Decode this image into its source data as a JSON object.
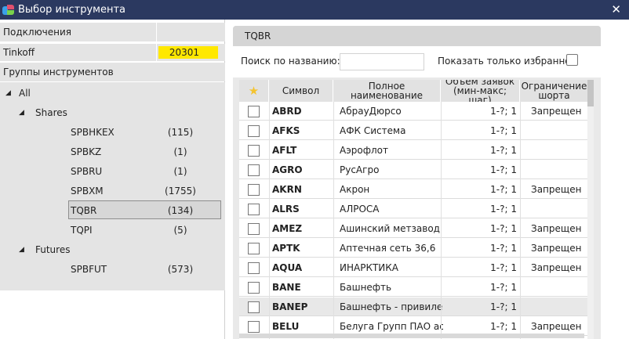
{
  "window": {
    "title": "Выбор инструмента",
    "close_label": "✕"
  },
  "left": {
    "connections_header": "Подключения",
    "connection": {
      "name": "Tinkoff",
      "count": "20301"
    },
    "groups_header": "Группы инструментов",
    "tree": [
      {
        "arrow": "◢",
        "name": "All",
        "count": ""
      },
      {
        "arrow": "◢",
        "name": "Shares",
        "count": ""
      },
      {
        "arrow": "",
        "name": "SPBHKEX",
        "count": "(115)"
      },
      {
        "arrow": "",
        "name": "SPBKZ",
        "count": "(1)"
      },
      {
        "arrow": "",
        "name": "SPBRU",
        "count": "(1)"
      },
      {
        "arrow": "",
        "name": "SPBXM",
        "count": "(1755)"
      },
      {
        "arrow": "",
        "name": "TQBR",
        "count": "(134)"
      },
      {
        "arrow": "",
        "name": "TQPI",
        "count": "(5)"
      },
      {
        "arrow": "◢",
        "name": "Futures",
        "count": ""
      },
      {
        "arrow": "",
        "name": "SPBFUT",
        "count": "(573)"
      }
    ]
  },
  "right": {
    "tab_title": "TQBR",
    "search_label": "Поиск по названию:",
    "search_value": "",
    "favorites_label": "Показать только избранное",
    "columns": {
      "star": "★",
      "symbol": "Символ",
      "full_name": "Полное наименование",
      "volume_l1": "Объем заявок",
      "volume_l2": "(мин-макс; шаг)",
      "limit_l1": "Ограничение",
      "limit_l2": "шорта"
    },
    "rows": [
      {
        "symbol": "ABRD",
        "name": "АбрауДюрсо",
        "volume": "1-?; 1",
        "limit": "Запрещен"
      },
      {
        "symbol": "AFKS",
        "name": "АФК Система",
        "volume": "1-?; 1",
        "limit": ""
      },
      {
        "symbol": "AFLT",
        "name": "Аэрофлот",
        "volume": "1-?; 1",
        "limit": ""
      },
      {
        "symbol": "AGRO",
        "name": "РусАгро",
        "volume": "1-?; 1",
        "limit": ""
      },
      {
        "symbol": "AKRN",
        "name": "Акрон",
        "volume": "1-?; 1",
        "limit": "Запрещен"
      },
      {
        "symbol": "ALRS",
        "name": "АЛРОСА",
        "volume": "1-?; 1",
        "limit": ""
      },
      {
        "symbol": "AMEZ",
        "name": "Ашинский метзавод",
        "volume": "1-?; 1",
        "limit": "Запрещен"
      },
      {
        "symbol": "APTK",
        "name": "Аптечная сеть 36,6",
        "volume": "1-?; 1",
        "limit": "Запрещен"
      },
      {
        "symbol": "AQUA",
        "name": "ИНАРКТИКА",
        "volume": "1-?; 1",
        "limit": "Запрещен"
      },
      {
        "symbol": "BANE",
        "name": "Башнефть",
        "volume": "1-?; 1",
        "limit": ""
      },
      {
        "symbol": "BANEP",
        "name": "Башнефть - привиле...",
        "volume": "1-?; 1",
        "limit": ""
      },
      {
        "symbol": "BELU",
        "name": "Белуга Групп ПАО ао",
        "volume": "1-?; 1",
        "limit": "Запрещен"
      }
    ]
  }
}
